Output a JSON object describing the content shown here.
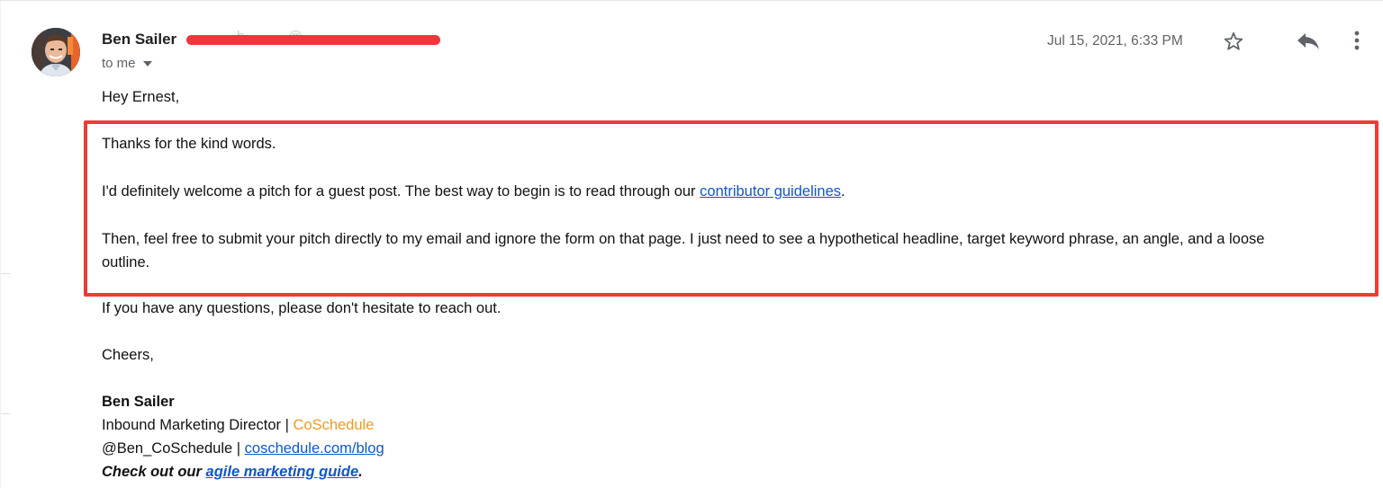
{
  "sender": {
    "name": "Ben Sailer",
    "email_redacted": "b········@··········",
    "recipient": "to me"
  },
  "date": "Jul 15, 2021, 6:33 PM",
  "icons": {
    "star": "star-icon",
    "reply": "reply-icon",
    "more": "more-vertical-icon",
    "dropdown": "caret-down-icon"
  },
  "body": {
    "greeting": "Hey Ernest,",
    "p1": "Thanks for the kind words.",
    "p2_before": "I'd definitely welcome a pitch for a guest post. The best way to begin is to read through our ",
    "p2_link": "contributor guidelines",
    "p2_after": ".",
    "p3_line1": "Then, feel free to submit your pitch directly to my email and ignore the form on that page. I just need to see a hypothetical headline, target keyword phrase, an angle, and a loose",
    "p3_line2": "outline.",
    "p4": "If you have any questions, please don't hesitate to reach out.",
    "closing": "Cheers,"
  },
  "signature": {
    "name": "Ben Sailer",
    "title_prefix": "Inbound Marketing Director | ",
    "company": "CoSchedule",
    "handle_prefix": "@Ben_CoSchedule | ",
    "blog_link": "coschedule.com/blog",
    "cta_prefix": "Check out our ",
    "cta_link": "agile marketing guide",
    "cta_suffix": "."
  },
  "colors": {
    "highlight_border": "#ee3b35",
    "link": "#1155cc",
    "brand_orange": "#f39a1d"
  }
}
